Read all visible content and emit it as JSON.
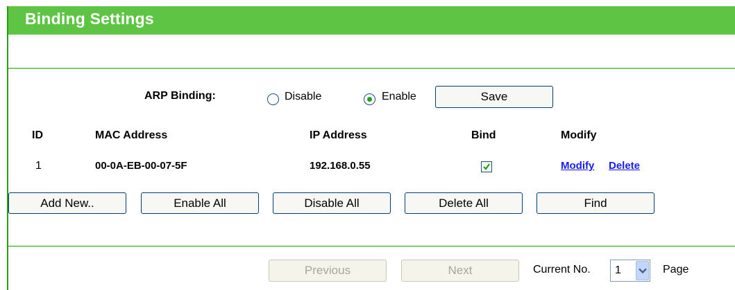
{
  "header": {
    "title": "Binding Settings"
  },
  "arp": {
    "label": "ARP Binding:",
    "options": [
      {
        "label": "Disable",
        "selected": false
      },
      {
        "label": "Enable",
        "selected": true
      }
    ],
    "save_label": "Save"
  },
  "table": {
    "columns": {
      "id": "ID",
      "mac": "MAC Address",
      "ip": "IP Address",
      "bind": "Bind",
      "modify": "Modify"
    },
    "rows": [
      {
        "id": "1",
        "mac": "00-0A-EB-00-07-5F",
        "ip": "192.168.0.55",
        "bind": true,
        "modify_link": "Modify",
        "delete_link": "Delete"
      }
    ]
  },
  "actions": {
    "add_new": "Add New..",
    "enable_all": "Enable All",
    "disable_all": "Disable All",
    "delete_all": "Delete All",
    "find": "Find"
  },
  "pagination": {
    "previous": "Previous",
    "next": "Next",
    "current_label": "Current No.",
    "current_value": "1",
    "page_label": "Page"
  },
  "colors": {
    "header_bg": "#5ec544",
    "link": "#1a1aff",
    "radio_dot": "#21a121"
  }
}
